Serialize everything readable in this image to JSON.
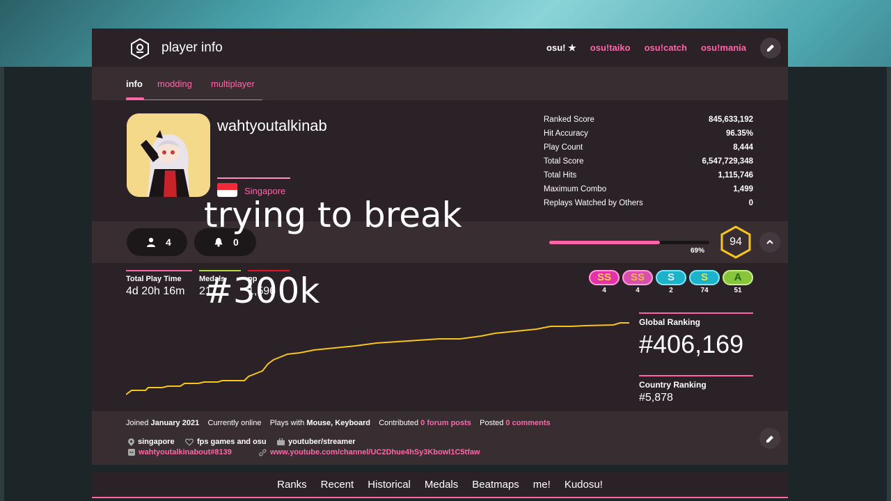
{
  "header": {
    "title": "player info",
    "modes": [
      {
        "label": "osu!",
        "active": true
      },
      {
        "label": "osu!taiko",
        "active": false
      },
      {
        "label": "osu!catch",
        "active": false
      },
      {
        "label": "osu!mania",
        "active": false
      }
    ]
  },
  "tabs": [
    "info",
    "modding",
    "multiplayer"
  ],
  "profile": {
    "username": "wahtyoutalkinab",
    "country": "Singapore"
  },
  "stats": [
    {
      "label": "Ranked Score",
      "value": "845,633,192"
    },
    {
      "label": "Hit Accuracy",
      "value": "96.35%"
    },
    {
      "label": "Play Count",
      "value": "8,444"
    },
    {
      "label": "Total Score",
      "value": "6,547,729,348"
    },
    {
      "label": "Total Hits",
      "value": "1,115,746"
    },
    {
      "label": "Maximum Combo",
      "value": "1,499"
    },
    {
      "label": "Replays Watched by Others",
      "value": "0"
    }
  ],
  "social": {
    "followers": "4",
    "subscribers": "0"
  },
  "level": {
    "progress_label": "69%",
    "progress": 0.69,
    "value": "94"
  },
  "overlay": {
    "line1": "trying to break",
    "line2": "#300k"
  },
  "summary": [
    {
      "label": "Total Play Time",
      "value": "4d 20h 16m",
      "color": "#ff66aa"
    },
    {
      "label": "Medals",
      "value": "21",
      "color": "#b3d944"
    },
    {
      "label": "pp",
      "value": "1,596",
      "color": "#ed1121"
    }
  ],
  "grades": [
    {
      "label": "SS",
      "count": "4",
      "bg": "#e631a9",
      "fg": "#f5d44a",
      "ring": "#ff9ed8"
    },
    {
      "label": "SS",
      "count": "4",
      "bg": "#d94fb0",
      "fg": "#f0b64a",
      "ring": "#ff9ed8"
    },
    {
      "label": "S",
      "count": "2",
      "bg": "#1cb2c9",
      "fg": "#e8eef0",
      "ring": "#7fe5f5"
    },
    {
      "label": "S",
      "count": "74",
      "bg": "#1cb2c9",
      "fg": "#e6e24a",
      "ring": "#7fe5f5"
    },
    {
      "label": "A",
      "count": "51",
      "bg": "#88c53a",
      "fg": "#1f6a1a",
      "ring": "#c5f08a"
    }
  ],
  "rankings": {
    "global_label": "Global Ranking",
    "global_value": "#406,169",
    "country_label": "Country Ranking",
    "country_value": "#5,878"
  },
  "footer": {
    "joined_prefix": "Joined",
    "joined": "January 2021",
    "online": "Currently online",
    "plays_prefix": "Plays with",
    "plays": "Mouse, Keyboard",
    "contributed_prefix": "Contributed",
    "forum_posts": "0 forum posts",
    "posted_prefix": "Posted",
    "comments": "0 comments",
    "location": "singapore",
    "interests": "fps games and osu",
    "occupation": "youtuber/streamer",
    "discord": "wahtyoutalkinabout#8139",
    "website": "www.youtube.com/channel/UC2Dhue4hSy3Kbowl1C5tfaw"
  },
  "nav": [
    "Ranks",
    "Recent",
    "Historical",
    "Medals",
    "Beatmaps",
    "me!",
    "Kudosu!"
  ],
  "accent_color": "#ff66aa"
}
